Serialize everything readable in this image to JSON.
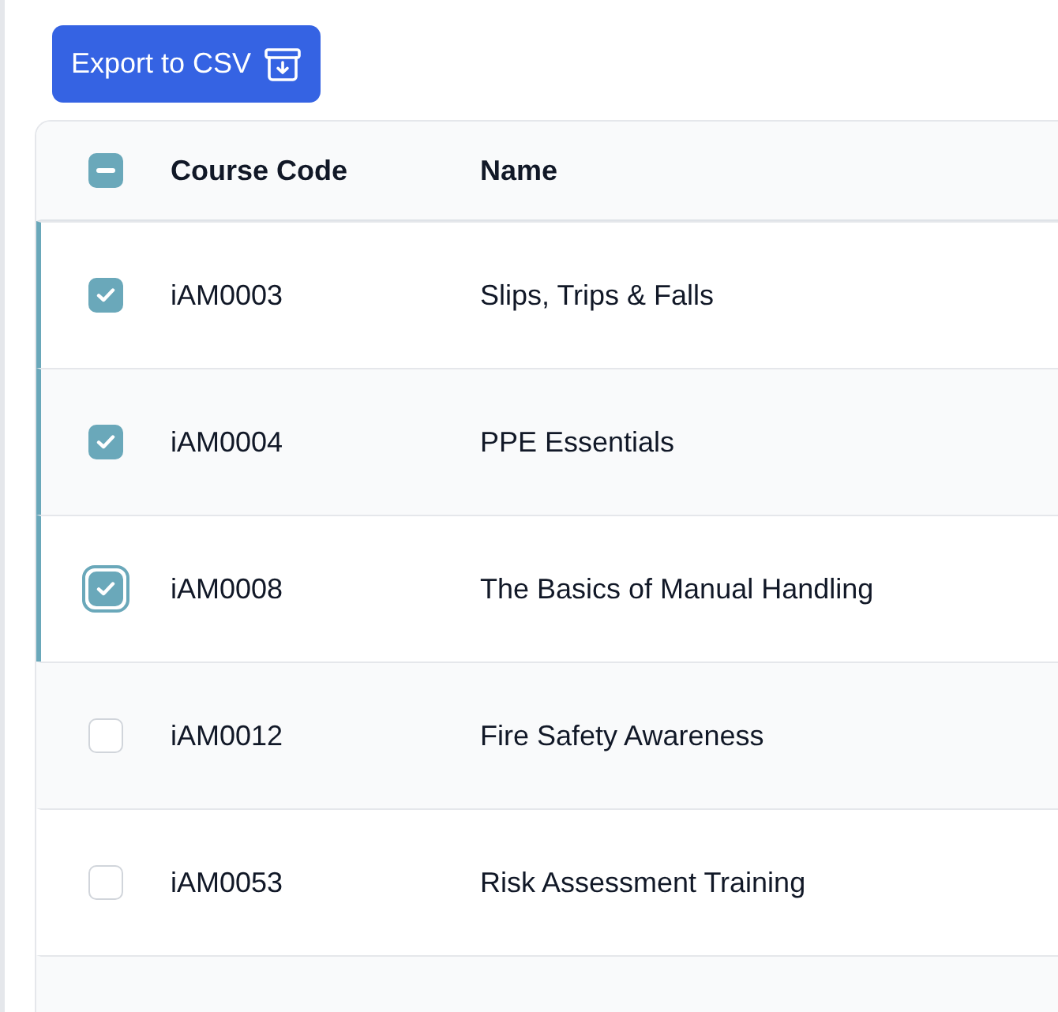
{
  "export_button": {
    "label": "Export to CSV"
  },
  "table": {
    "select_all": {
      "indeterminate": true
    },
    "columns": [
      "Course Code",
      "Name"
    ],
    "rows": [
      {
        "code": "iAM0003",
        "name": "Slips, Trips & Falls",
        "selected": true,
        "focused": false
      },
      {
        "code": "iAM0004",
        "name": "PPE Essentials",
        "selected": true,
        "focused": false
      },
      {
        "code": "iAM0008",
        "name": "The Basics of Manual Handling",
        "selected": true,
        "focused": true
      },
      {
        "code": "iAM0012",
        "name": "Fire Safety Awareness",
        "selected": false,
        "focused": false
      },
      {
        "code": "iAM0053",
        "name": "Risk Assessment Training",
        "selected": false,
        "focused": false
      }
    ]
  }
}
